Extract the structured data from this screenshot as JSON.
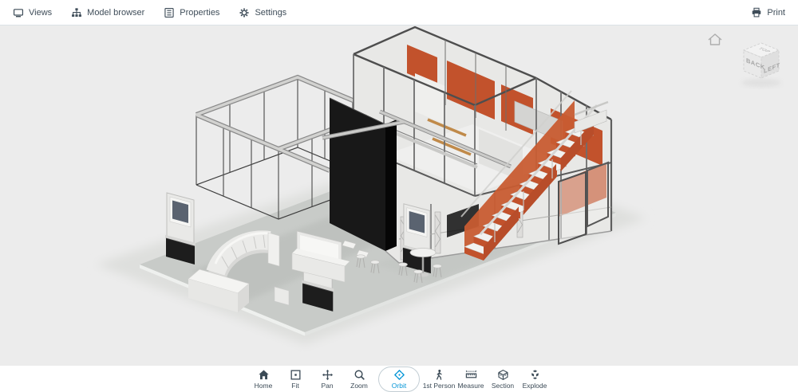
{
  "top_toolbar": {
    "left_items": [
      {
        "id": "views",
        "label": "Views",
        "icon": "views-icon"
      },
      {
        "id": "model-browser",
        "label": "Model browser",
        "icon": "model-browser-icon"
      },
      {
        "id": "properties",
        "label": "Properties",
        "icon": "properties-icon"
      },
      {
        "id": "settings",
        "label": "Settings",
        "icon": "settings-icon"
      }
    ],
    "right_items": [
      {
        "id": "print",
        "label": "Print",
        "icon": "print-icon"
      }
    ]
  },
  "bottom_toolbar": {
    "items": [
      {
        "id": "home",
        "label": "Home",
        "icon": "home-icon",
        "active": false
      },
      {
        "id": "fit",
        "label": "Fit",
        "icon": "fit-icon",
        "active": false
      },
      {
        "id": "pan",
        "label": "Pan",
        "icon": "pan-icon",
        "active": false
      },
      {
        "id": "zoom",
        "label": "Zoom",
        "icon": "zoom-icon",
        "active": false
      },
      {
        "id": "orbit",
        "label": "Orbit",
        "icon": "orbit-icon",
        "active": true
      },
      {
        "id": "first-person",
        "label": "1st Person",
        "icon": "first-person-icon",
        "active": false
      },
      {
        "id": "measure",
        "label": "Measure",
        "icon": "measure-icon",
        "active": false
      },
      {
        "id": "section",
        "label": "Section",
        "icon": "section-icon",
        "active": false
      },
      {
        "id": "explode",
        "label": "Explode",
        "icon": "explode-icon",
        "active": false
      }
    ]
  },
  "viewcube": {
    "faces": {
      "top": "TOP",
      "left": "BACK",
      "right": "LEFT"
    }
  },
  "colors": {
    "accent_blue": "#0696d7",
    "panel_orange": "#c2522c",
    "stair_orange": "#b84d2a",
    "wall_black": "#181818",
    "floor_gray": "#c8cbc8",
    "viewport_background": "#ececec"
  }
}
